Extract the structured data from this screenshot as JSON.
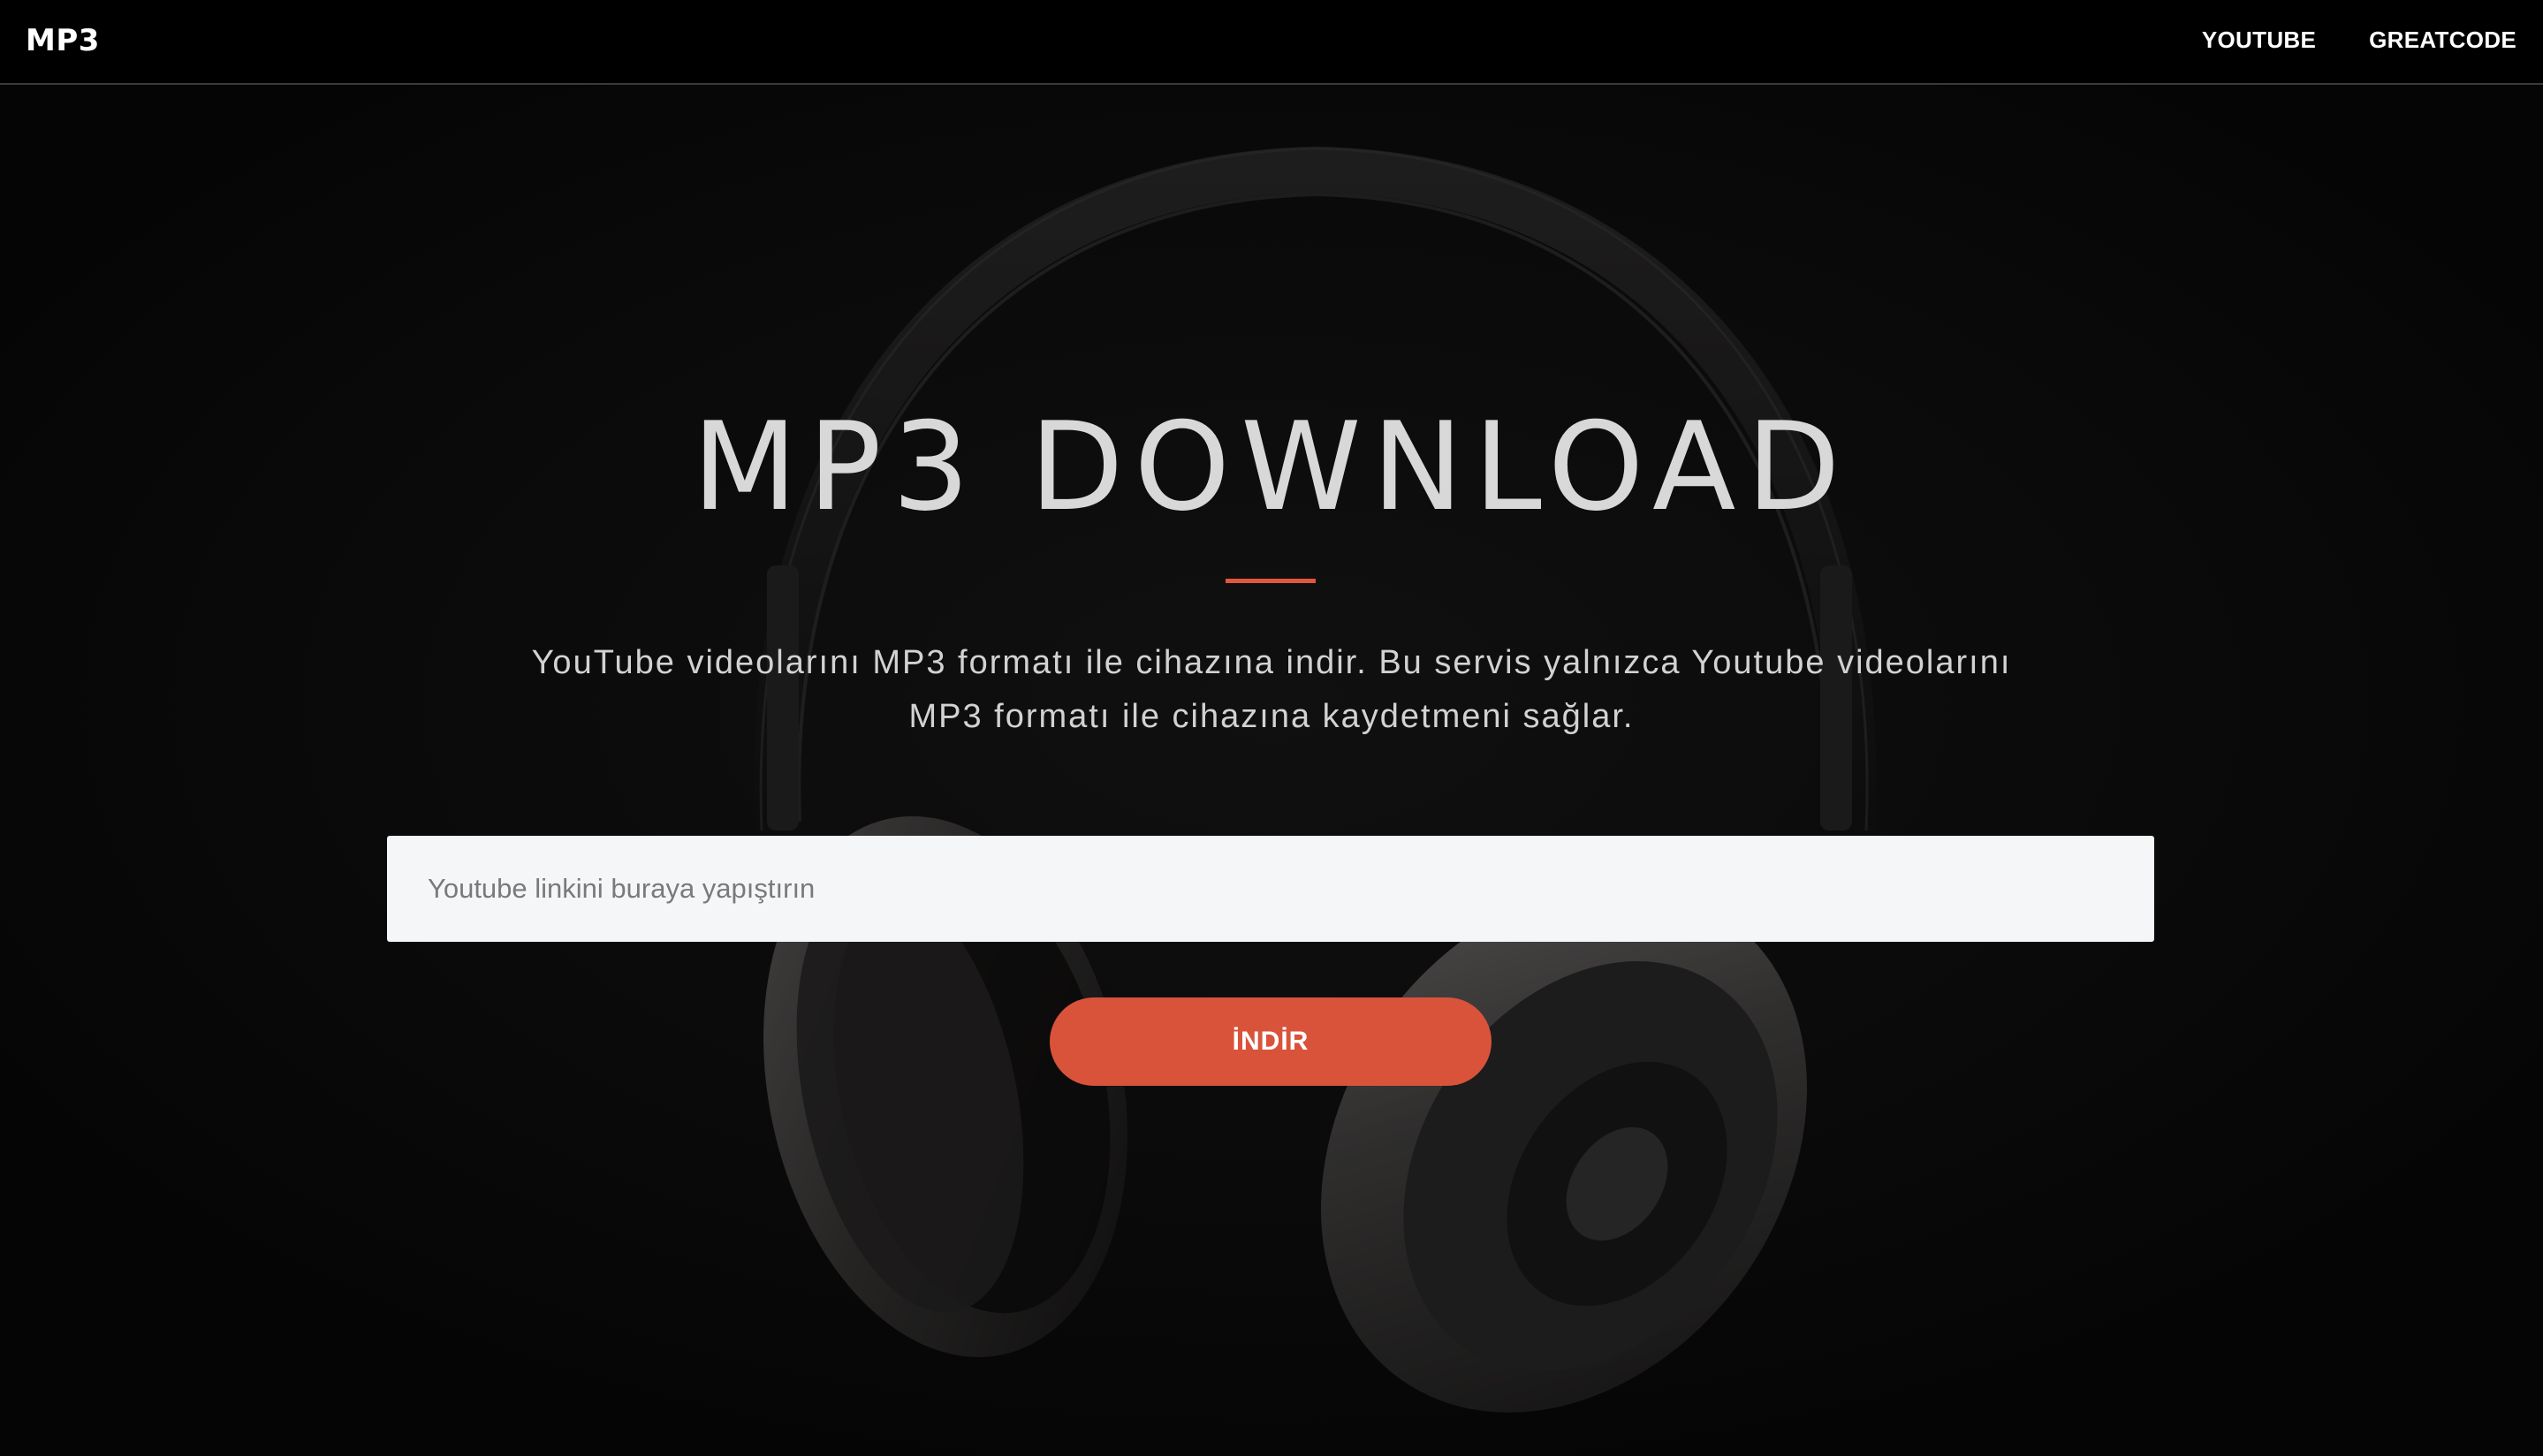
{
  "navbar": {
    "brand": "MP3",
    "links": [
      {
        "label": "YOUTUBE"
      },
      {
        "label": "GREATCODE"
      }
    ]
  },
  "hero": {
    "title": "MP3 DOWNLOAD",
    "description": "YouTube videolarını MP3 formatı ile cihazına indir. Bu servis yalnızca Youtube videolarını MP3 formatı ile cihazına kaydetmeni sağlar.",
    "accent_color": "#e0573d"
  },
  "form": {
    "url_input": {
      "value": "",
      "placeholder": "Youtube linkini buraya yapıştırın"
    },
    "submit_label": "İNDİR",
    "button_color": "#d9533b"
  },
  "background": {
    "image": "headphones-image"
  }
}
